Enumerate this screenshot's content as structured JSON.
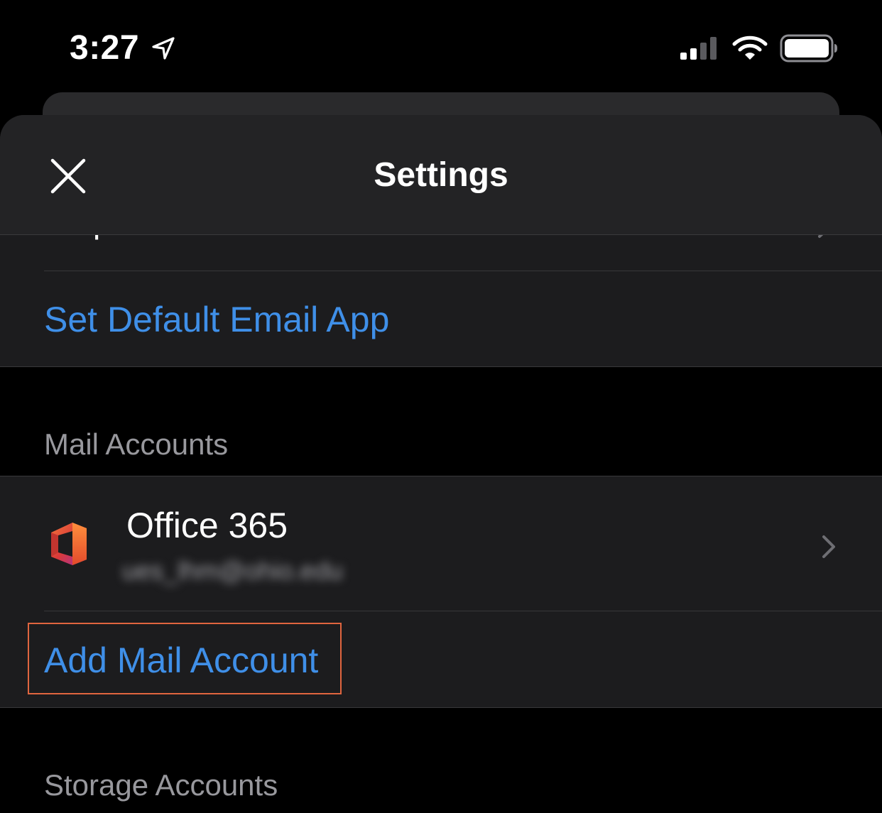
{
  "status_bar": {
    "time": "3:27",
    "location_icon": "location-arrow-icon",
    "signal_icon": "cellular-signal-icon",
    "wifi_icon": "wifi-icon",
    "battery_icon": "battery-icon"
  },
  "header": {
    "title": "Settings",
    "close_icon": "close-icon"
  },
  "list": {
    "partial_row_label": "Help & Feedback",
    "set_default_label": "Set Default Email App",
    "mail_accounts_header": "Mail Accounts",
    "office_account": {
      "title": "Office 365",
      "email": "ues_lhm@ohio.edu",
      "icon": "office-365-icon"
    },
    "add_mail_account_label": "Add Mail Account",
    "storage_accounts_header": "Storage Accounts"
  },
  "colors": {
    "link": "#3f8fe8",
    "highlight": "#e0653f",
    "sheet_bg": "#1c1c1e",
    "header_bg": "#232325",
    "section_text": "#98989d"
  }
}
